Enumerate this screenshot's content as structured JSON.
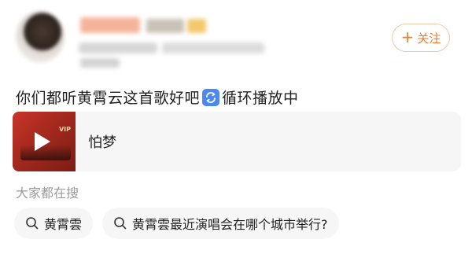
{
  "header": {
    "follow_label": "关注",
    "follow_plus": "+"
  },
  "post": {
    "text_before": "你们都听黄霄云这首歌好吧",
    "text_after": "循环播放中",
    "icon": "repeat-icon"
  },
  "music_card": {
    "song_title": "怕梦",
    "badge": "VIP"
  },
  "related": {
    "label": "大家都在搜",
    "chips": [
      {
        "label": "黄霄雲",
        "icon": "search-icon"
      },
      {
        "label": "黄霄雲最近演唱会在哪个城市举行?",
        "icon": "search-icon"
      }
    ]
  },
  "colors": {
    "accent": "#f07c2e",
    "repeat_icon_bg": "#4b89f0",
    "muted_text": "#9a9a9a",
    "card_bg": "#f6f6f6"
  }
}
